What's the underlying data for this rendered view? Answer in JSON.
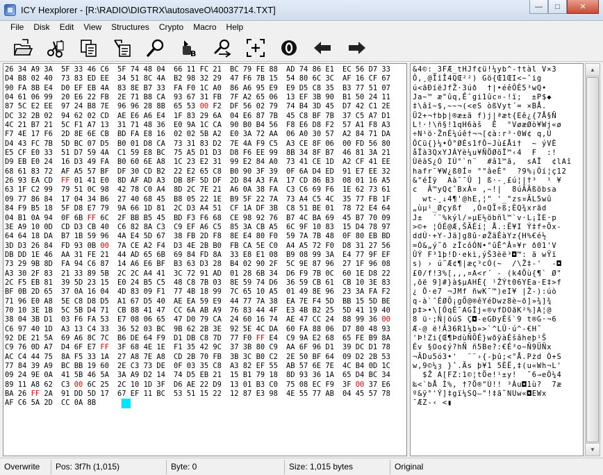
{
  "window": {
    "title": "ICY Hexplorer - [R:\\RADIO\\DIGTRX\\autosaveO\\40037714.TXT]",
    "min_label": "—",
    "max_label": "□",
    "close_label": "✕"
  },
  "menu": [
    "File",
    "Disk",
    "Edit",
    "View",
    "Structures",
    "Crypto",
    "Macro",
    "Help"
  ],
  "toolbar": [
    {
      "name": "open-icon"
    },
    {
      "name": "cut-icon"
    },
    {
      "name": "copy-icon"
    },
    {
      "name": "paste-icon"
    },
    {
      "name": "search-icon"
    },
    {
      "name": "replace-icon"
    },
    {
      "name": "find-next-icon"
    },
    {
      "name": "select-block-icon"
    },
    {
      "name": "goto-offset-icon"
    },
    {
      "name": "back-arrow-icon"
    },
    {
      "name": "forward-arrow-icon"
    }
  ],
  "hex_rows": [
    "26 34 A9 3A|5F 33 46 C6|5F 74 48 04|66 11 FC 21|BC 79 FE 88|AD 74 86 E1|EC 56 D7 33",
    "D4 B8 02 40|73 83 ED EE|34 51 8C 4A|B2 98 32 29|47 F6 7B 15|54 80 6C 3C|AF 16 CF 67",
    "90 FA 8B E4|D0 EF EB 4A|83 8E B7 33|FA F0 1C A0|86 A6 95 E9|E9 D5 C8 35|B3 77 51 07",
    "04 61 06 99|20 E6 22 FB|2E 71 B8 CA|93 67 31 FB|7F A2 65 06|13 EF 3B 90|B1 50 24 11",
    "87 5C E2 EE|97 24 B8 7E|96 96 28 8B|65 53 ~00~ F2|DF 56 02 79|74 B4 3D 45|D7 42 C1 2E",
    "DC 32 2B 02|94 62 02 CD|AE E6 A6 E4|1F 83 29 6A|04 E6 87 7B|45 C8 BF 7B|37 C5 A7 D1",
    "4C 21 B7 21|5C F1 A7 13|31 71 48 36|E0 9A 1C CA|90 B0 B4 56|F8 E6 D8 F2|57 A1 F8 A3",
    "F7 4E 17 F6|2D 8E 6E CB|BD FA E8 16|02 02 5B A2|E0 3A 72 AA|06 A0 30 57|A2 84 71 DA",
    "D4 43 FC 7B|5D BC 07 D5|B0 01 D8 CA|73 31 83 D2|7E 4A F9 C5|A3 CE 8F 06|00 FD 56 80",
    "E5 CF E0 33|51 D7 59 4A|C1 59 E8 BC|75 A5 D1 D3|D8 F6 EE 99|8B 34 8F B7|46 81 3A 21",
    "D9 EB E0 24|16 D3 49 FA|B0 60 6E A8|1C 23 E2 31|99 E2 84 A0|73 41 CE 1D|A2 CF 41 EE",
    "68 61 83 72|AF A5 57 BF|DF 30 CD B2|22 E2 65 C8|B0 90 3F 39|0F 6A D4 ED|91 E7 EE 32",
    "26 93 EA CD|~FF~ 01 41 E0|8D AF AD A3|DB 8F 5D DF|2D 84 A3 FA|17 CD 86 B3|08 01 16 A5",
    "63 1F C2 99|79 51 0C 98|42 78 C0 A4|8D 2C 7E 21|A6 0A 38 FA|C3 C6 69 F6|1E 62 73 61",
    "09 77 86 84|17 04 34 B6|27 40 68 45|B8 05 22 1E|B9 5F 22 7A|73 A4 C5 4C|35 77 FB 1F",
    "84 F9 B5 18|5F D8 E7 79|9A 66 1D 81|2C D3 A4 51|CF 1A DF 3B|C8 51 BE 01|78 72 E4 64",
    "04 B1 0A 94|0F 6B ~FF~ 6C|2F BB B5 45|BD F3 F6 68|CE 98 92 76|B7 4C BA 69|45 B7 70 09",
    "3E A9 10 0D|CD D3 CB 40|C6 82 8A C3|C9 EF A6 C5|85 3A CB A5|6C 9F 10 83|15 D4 78 97",
    "64 64 18 DA|B7 1B 59 96|4A E4 5D 67|38 FB 2D F8|8E E4 80 F0|59 7A 7B 48|0F 80 EB BD",
    "3D D3 26 84|FD 93 0B ~00~|7A CE A2 F4|D3 4E 2B B0|FB CA 5E C0|A4 A5 72 F0|D8 31 27 56",
    "DB DD 1E 46|AA 31 FE 21|44 AD 65 6B|69 84 FD 8A|33 E8 E1 08|B9 08 99 3A|E4 77 9F EF",
    "73 29 9B 8D|FA 94 C6 87|14 A6 E6 BF|B3 63 D3 28|B4 02 90 2F|5C 9E 87 96|27 1F 96 08",
    "A3 30 2F 83|21 33 89 5B|2C 2C A4 41|3C 72 91 AD|01 28 6B 34|D6 F9 7B 0C|60 1E D8 22",
    "2C F5 EB 81|39 5D 23 15|E0 24 B5 C5|48 C8 7B 03|8E 59 74 D6|36 59 CB 61|CB 10 3E 83",
    "BF 0B 2D 65|37 0A 16 04|4D 83 09 F1|77 4B 18 99|7C 65 10 A5|01 49 8E 96|23 3A FA F2",
    "71 96 E0 A8|5E C8 D8 D5|A1 67 D5 40|AE EA 59 E9|44 77 7A 38|EA 7E F4 5D|BB 15 5D BE",
    "70 10 3E 1B|5C 5B D4 71|CB 88 41 47|CC 6A AB A9|76 83 44 4F|E3 4B B2 25|5D 41 19 40",
    "38 04 3B D1|03 F6 FA 53|E7 08 06 65|47 D0 79 CA|24 60 16 74|AE 47 CC 24|88 99 36 ~00~",
    "C6 97 40 1D|A3 13 C4 33|36 52 03 BC|9B 62 2B 3E|92 5E 4C DA|60 FA 88 06|D7 80 48 93",
    "92 DE 21 5A|69 A6 8C 7C|B6 DE 64 F9|D1 DB C8 7D|77 F0 ~FF~ E4|C9 9A E2 68|65 FE B9 8A",
    "C9 76 0D A7|D4 6F E7 ~FF~|3F 68 4E 1E|F1 35 42 9C|37 3B 80 C9|AA 6F 96 D1|39 DC D1 78",
    "AC C4 44 75|8A F5 33 1A|27 A8 7E A8|CD 2B 70 FB|3B 3C B0 C2|2E 50 BF 64|09 D2 2B 53",
    "77 84 39 A9|BC BB 19 60|2E C3 73 DE|0F 03 35 C8|A3 82 EF 55|AB 57 6E 7E|4C B4 0D 1C",
    "09 24 9E 0A|41 5B 46 5A|3A A9 D2 14|74 D5 EB 21|15 B1 79 18|8D 93 36 1A|65 D4 BC 34",
    "89 11 A8 62|C3 ~00~ 6C 25|2C 10 1D 3F|D6 AE 22 D9|13 01 B3 C0|75 08 EC F9|3F ~00~ 37 E6",
    "BA 26 ~FF~ 2A|91 DD 5D 17|67 EF 11 BC|53 51 15 22|12 87 E3 98|4E 55 77 AB|04 45 57 78",
    "AF C6 5A 2D|CC 0A 8B"
  ],
  "ascii_rows": [
    "&4©:_3FÆ_tHJf¢ü!¼yb^-†tàl V×3",
    "Ô,¸@ÎîÎ4QŒ²²) Gö{Œ1ŒI<~ˆig",
    "ú<ãÐïëJfŽ·3úð  †|•éêÔÈ5³wQ•",
    "Ja~™ æ\"ûq,Ê¯gi1ûc¤-!ï;  ±P$◆",
    "‡\\âî~$,~~¬(<eS òßVyt´= ×BÅ.",
    "Ü2+¬†bþ|®æ±ã f)j|ªæt{Eê¿{7Å§Ñ",
    "L!·!\\ñ§!1qH6àš  Ê  °VøæØò¥Wj«ø",
    "÷N¹ö·ŽnÉ¼úê†¬¬[¢à:r³·0W¢ q,Ú",
    "ÔCü{}¼•Ô°ØÉs1fÔ~Jù£Åi†  ~ ýVÈ",
    "åÏà3QxYJÁYè¼u¥ÑÖØöÏ™‹4  F  :!",
    "ÙëàS¿Ó IÚ°`n¨  #â1™ã,  sAÎ  ¢lAî",
    "hafr¯¥W¿ß0Í¤ °\"âeÈ°  ?9%¡Ôí¦ç12",
    "&°éÍÿ  Aà¯¯Û ] ß·-¸£ú¦|†³  ¹ ¥",
    "c  Â™yQ¢ˆBxÀ¤ ,~!|  8úÃÃßöbsa",
    "  wt-¸↓4¶'@hE,¦\" '_\"zs¤ÃL5wû",
    "„ùµ¹_Øçyßf  ,Ó¤QÏ÷ß;ÈQ¾xrãd",
    "J±  ´¨%kýl/»µE½öbñl™`v·L¡ÌE·p",
    ">©+ ¦ÓÉ@Æ,ŠÃÉí¦ Å.:Ë¥I Ý‡f÷Öx-",
    "ddÚ·+Y-Jä]g8û·øŽäÊàYz{H%€é½",
    "=Ó&„ý˜ð zÎcôÓN•°ûÊ^Â¤¥r ð01'V",
    "ÛÝ F³1þ!D·ekì,ýŠ3èë³◘™: ä wŸï",
    "s) › ú˜Æ¢¶|æç³cÓ(~  /\\Ž‡-'  -◘",
    "£0/f!3%[,,,¤A<r´ - (k4Öù{¶` Ø\"",
    ",õë 9]#}à$µAHÉ{ ¹ŽÝt06YEa·E‡>f",
    "¿ Ô·e7 ¬JMf ñwK¯™)eI¥ |Ž-):úò",
    "q-à`ˆÉØÕ¡gÕ@®êYéDwz8è~õ]»¾]¾",
    "p‡>•\\[ÔqÉ¯AGÌj«®vfDOãK²%]A¦@",
    "8 ü·;Ñ|öúS Ç◘-eGÐyÈš`9 t®G·¬6",
    "Æ-@ ë!Â36R1¼b»>`^LÛ·ú^-€H˜",
    "'Þ!Zi{Œ¶ÞdùÑÖÉ}wðÿàÉšâheþ¹Š",
    "Év §Oo¢ý?hÑ ñ5Be?:€É³o~Ñ9ÜÑx",
    "¬ÃDu5ó3•'  ¨¨›{-þû;<°Å.Pżd Ò+S",
    "w,9©¼ȝ }ˆ.Ãs þ¥1 5ÈË,‡(u«Wh¬L'",
    "  $Ž A[FZ:1©¦tÕe!¹±y!  ˜6→eÔ¼4",
    "‰<`bÅ Ì%, †?Ö®\"Ù!! ³Àu◘1ù?  7æ",
    "º&ÿ°'Ý]‡gï¼SQ–\"!‡ã˜NUw«◘EWx",
    "¯ÆZ-‹ <▮"
  ],
  "status": {
    "mode": "Overwrite",
    "position": "Pos: 3f7h (1,015)",
    "byte": "Byte: 0",
    "size": "Size: 1,015 bytes",
    "state": "Original"
  }
}
